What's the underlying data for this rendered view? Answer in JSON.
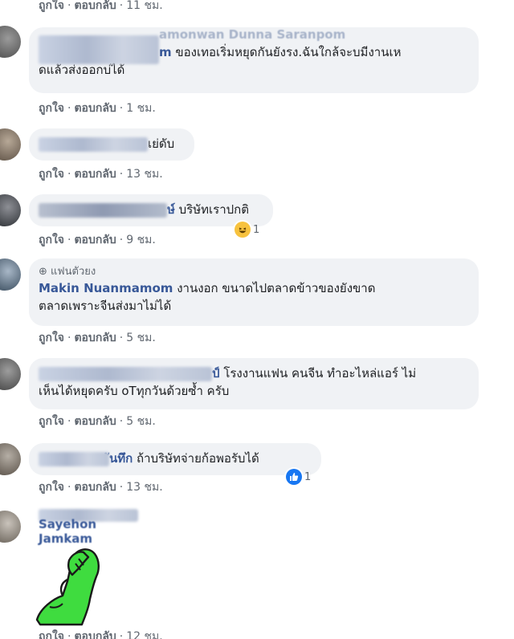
{
  "actions": {
    "like": "ถูกใจ",
    "reply": "ตอบกลับ",
    "dot": "·"
  },
  "comments": [
    {
      "time": "11 ชม."
    },
    {
      "name_visible": "amonwan Dunna Saranpom",
      "name_tail": "m",
      "text_1": "ของเทอเริ่มหยุดกันยังรง.ฉันใกล้จะบมีงานเห",
      "text_2": "ดแล้วส่งออกบ่ได้",
      "time": "1 ชม."
    },
    {
      "name_tail": "เย่ดับ",
      "time": "13 ชม."
    },
    {
      "name_tail": "ษ์",
      "text": "บริษัทเราปกติ",
      "time": "9 ชม.",
      "reaction_count": "1",
      "reaction_icon": "haha-emoji-icon"
    },
    {
      "badge": "แฟนตัวยง",
      "name_visible": "Makin Nuanmamom",
      "text_1": "งานงอก ขนาดไปตลาดข้าวของยังขาด",
      "text_2": "ตลาดเพราะจีนส่งมาไม่ได้",
      "time": "5 ชม."
    },
    {
      "name_tail": "ป์",
      "text_1": "โรงงานแฟน คนจีน ทำอะไหล่แอร์ ไม่",
      "text_2": "เห็นได้หยุดครับ oTทุกวันด้วยซ้ำ ครับ",
      "time": "5 ชม."
    },
    {
      "name_tail": "ันทึก",
      "text": "ถ้าบริษัทจ่ายก้อพอรับได้",
      "time": "13 ชม.",
      "reaction_count": "1",
      "reaction_icon": "like-icon"
    },
    {
      "name_visible": "Sayehon Jamkam",
      "time": "12 ชม.",
      "sticker": "green-facepalm-sticker"
    }
  ],
  "colors": {
    "bubble": "#f0f2f5",
    "name": "#385898",
    "meta": "#606770",
    "like_blue": "#1877f2",
    "haha_yellow": "#f7c23e",
    "sticker_green": "#3fdc3f"
  }
}
